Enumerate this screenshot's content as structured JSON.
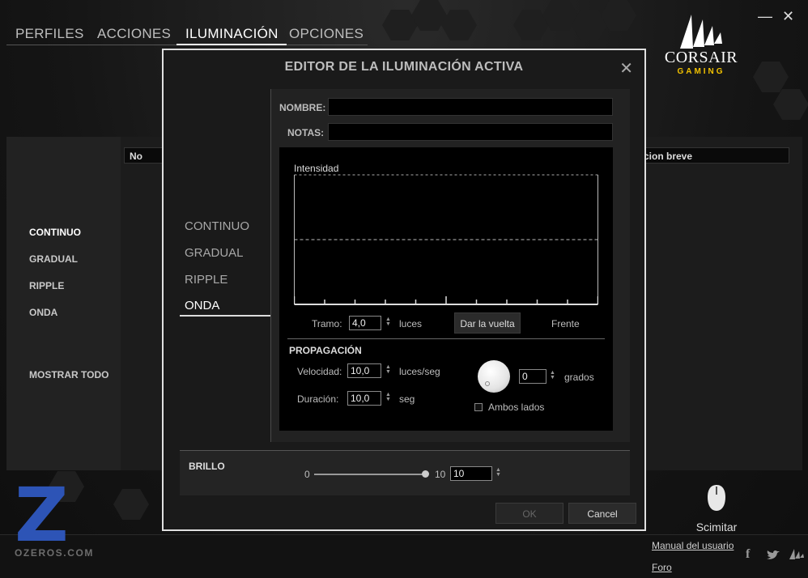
{
  "app": {
    "nav": [
      "PERFILES",
      "ACCIONES",
      "ILUMINACIÓN",
      "OPCIONES"
    ],
    "active_nav": "ILUMINACIÓN",
    "window_controls": {
      "minimize": "—",
      "close": "✕"
    },
    "brand": {
      "name": "CORSAIR",
      "sub": "GAMING"
    },
    "left_menu": [
      "CONTINUO",
      "GRADUAL",
      "RIPPLE",
      "ONDA",
      "MOSTRAR TODO"
    ],
    "columns": {
      "name_partial": "No",
      "desc_partial": "cion breve"
    },
    "device": "Scimitar",
    "footer": {
      "manual": "Manual del usuario",
      "forum": "Foro"
    },
    "watermark": {
      "letter": "Z",
      "site": "OZEROS.COM"
    }
  },
  "dialog": {
    "title": "EDITOR DE LA ILUMINACIÓN ACTIVA",
    "close": "✕",
    "modes": [
      "CONTINUO",
      "GRADUAL",
      "RIPPLE",
      "ONDA"
    ],
    "active_mode": "ONDA",
    "nombre": {
      "label": "NOMBRE:",
      "value": ""
    },
    "notas": {
      "label": "NOTAS:",
      "value": ""
    },
    "graph": {
      "label": "Intensidad",
      "tick_count": 11,
      "mid_level": 0.5
    },
    "tramo": {
      "label": "Tramo:",
      "value": "4,0",
      "unit": "luces"
    },
    "reverse_button": "Dar la vuelta",
    "front_label": "Frente",
    "propagation": {
      "heading": "PROPAGACIÓN",
      "speed": {
        "label": "Velocidad:",
        "value": "10,0",
        "unit": "luces/seg"
      },
      "duration": {
        "label": "Duración:",
        "value": "10,0",
        "unit": "seg"
      },
      "angle": {
        "value": "0",
        "unit": "grados"
      },
      "both_sides": {
        "label": "Ambos lados",
        "checked": false
      }
    },
    "brightness": {
      "label": "BRILLO",
      "min": "0",
      "max": "10",
      "value": "10"
    },
    "ok": "OK",
    "cancel": "Cancel"
  }
}
